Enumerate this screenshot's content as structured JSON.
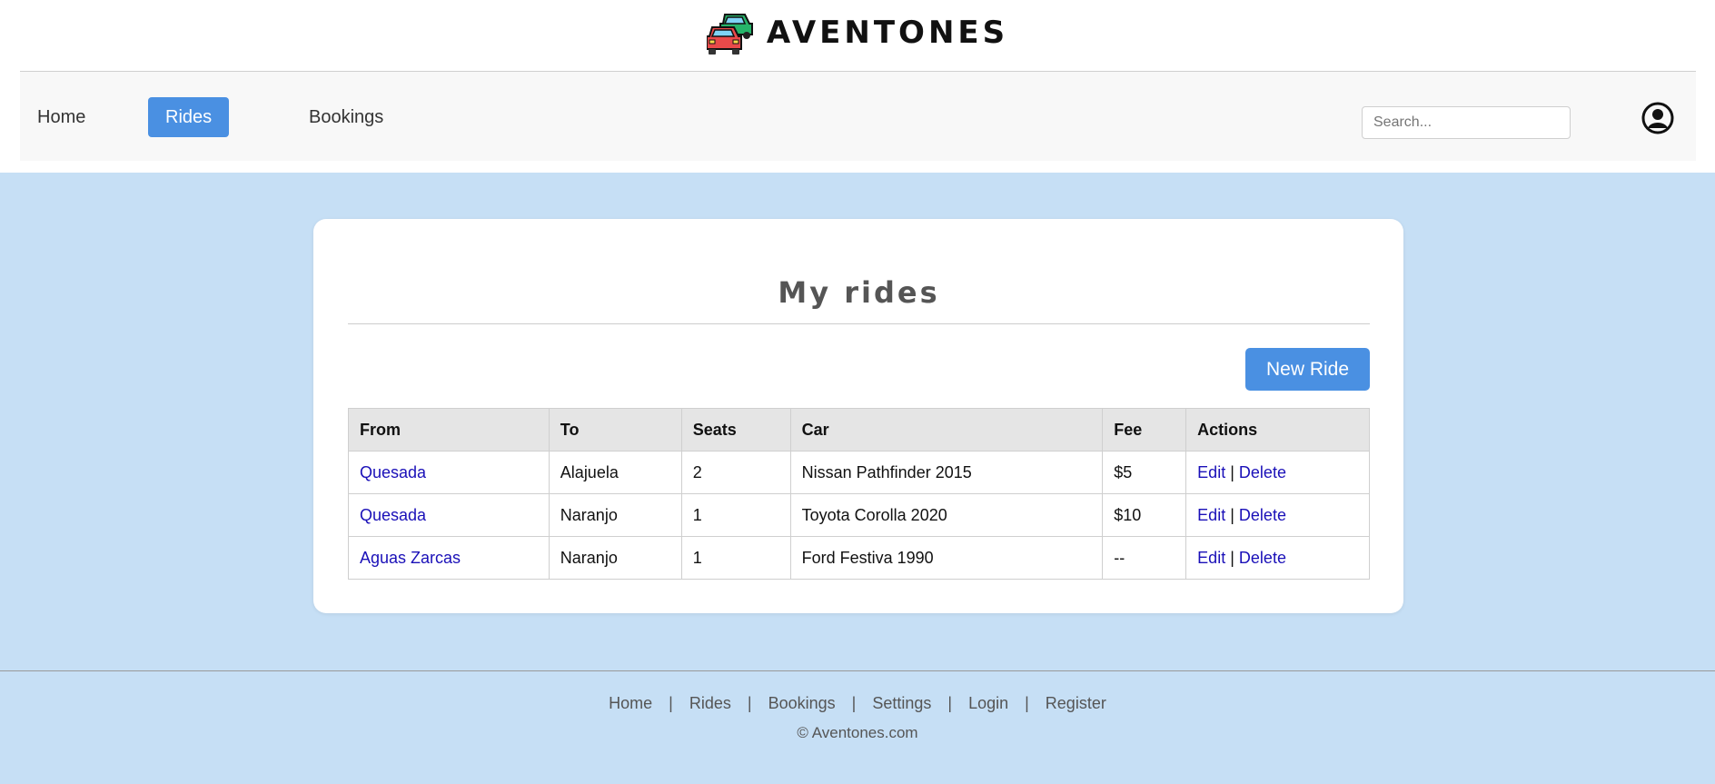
{
  "brand": {
    "name": "AVENTONES",
    "icon": "cars-icon"
  },
  "nav": {
    "items": [
      {
        "label": "Home"
      },
      {
        "label": "Rides",
        "active": true
      },
      {
        "label": "Bookings"
      }
    ],
    "search_placeholder": "Search...",
    "avatar_icon": "user-avatar-icon"
  },
  "main": {
    "title": "My rides",
    "new_button": "New Ride",
    "table": {
      "headers": [
        "From",
        "To",
        "Seats",
        "Car",
        "Fee",
        "Actions"
      ],
      "rows": [
        {
          "from": "Quesada",
          "to": "Alajuela",
          "seats": "2",
          "car": "Nissan Pathfinder 2015",
          "fee": "$5",
          "edit": "Edit",
          "sep": "|",
          "delete": "Delete"
        },
        {
          "from": "Quesada",
          "to": "Naranjo",
          "seats": "1",
          "car": "Toyota Corolla 2020",
          "fee": "$10",
          "edit": "Edit",
          "sep": "|",
          "delete": "Delete"
        },
        {
          "from": "Aguas Zarcas",
          "to": "Naranjo",
          "seats": "1",
          "car": "Ford Festiva 1990",
          "fee": "--",
          "edit": "Edit",
          "sep": "|",
          "delete": "Delete"
        }
      ]
    }
  },
  "footer": {
    "links": [
      "Home",
      "Rides",
      "Bookings",
      "Settings",
      "Login",
      "Register"
    ],
    "separator": "|",
    "copyright": "© Aventones.com"
  },
  "colors": {
    "accent": "#4a90e2",
    "page_background": "#c6dff5",
    "link": "#1a10b8"
  }
}
